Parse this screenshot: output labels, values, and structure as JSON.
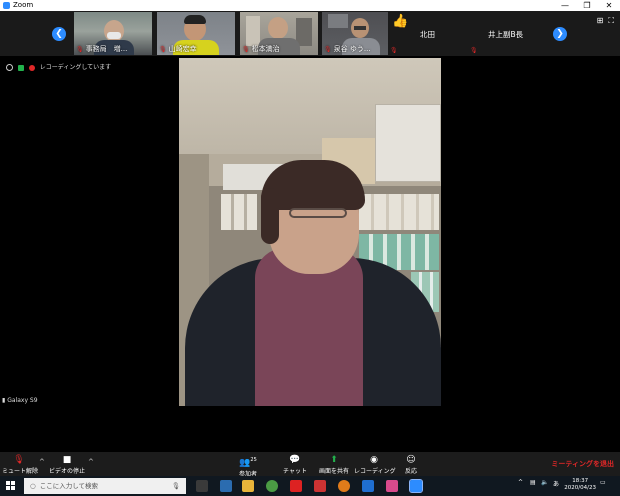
{
  "window": {
    "title": "Zoom"
  },
  "gallery": {
    "participants": [
      {
        "name": "事務局　増..."
      },
      {
        "name": "山崎宏幸"
      },
      {
        "name": "松本満治"
      },
      {
        "name": "泉谷 ゆう..."
      }
    ],
    "name_only": [
      {
        "name": "北田"
      },
      {
        "name": "井上副B長"
      }
    ]
  },
  "status": {
    "recording_text": "レコーディングしています"
  },
  "main_video": {
    "device_label": "Galaxy S9"
  },
  "controls": {
    "unmute_label": "ミュート解除",
    "stop_video_label": "ビデオの停止",
    "participants_label": "参加者",
    "participants_count": "25",
    "chat_label": "チャット",
    "share_label": "画面を共有",
    "record_label": "レコーディング",
    "reaction_label": "反応",
    "end_label": "ミーティングを退出"
  },
  "taskbar": {
    "search_placeholder": "ここに入力して検索",
    "ime_label": "あ",
    "time": "18:37",
    "date": "2020/04/23"
  },
  "colors": {
    "accent": "#2d8cff",
    "danger": "#e02828",
    "share": "#22b14c"
  }
}
